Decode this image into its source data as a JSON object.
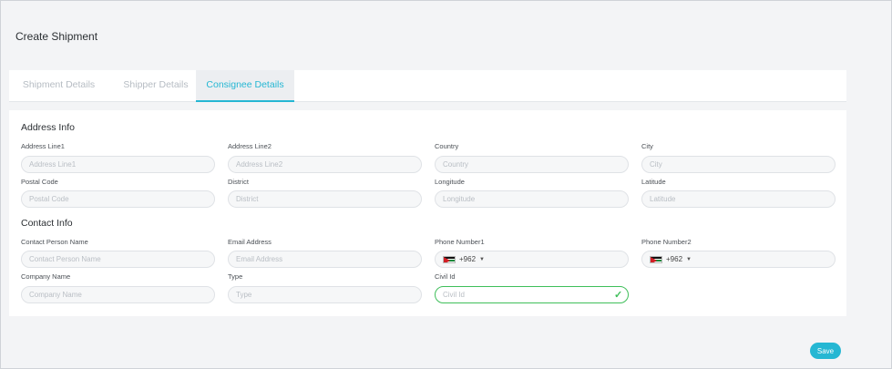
{
  "page": {
    "title": "Create Shipment"
  },
  "tabs": [
    {
      "label": "Shipment Details"
    },
    {
      "label": "Shipper Details"
    },
    {
      "label": "Consignee Details"
    }
  ],
  "active_tab": "Consignee Details",
  "address_info": {
    "title": "Address Info",
    "address_line1": {
      "label": "Address Line1",
      "placeholder": "Address Line1",
      "value": ""
    },
    "address_line2": {
      "label": "Address Line2",
      "placeholder": "Address Line2",
      "value": ""
    },
    "country": {
      "label": "Country",
      "placeholder": "Country",
      "value": ""
    },
    "city": {
      "label": "City",
      "placeholder": "City",
      "value": ""
    },
    "postal_code": {
      "label": "Postal Code",
      "placeholder": "Postal Code",
      "value": ""
    },
    "district": {
      "label": "District",
      "placeholder": "District",
      "value": ""
    },
    "longitude": {
      "label": "Longitude",
      "placeholder": "Longitude",
      "value": ""
    },
    "latitude": {
      "label": "Latitude",
      "placeholder": "Latitude",
      "value": ""
    }
  },
  "contact_info": {
    "title": "Contact Info",
    "contact_person_name": {
      "label": "Contact Person Name",
      "placeholder": "Contact Person Name",
      "value": ""
    },
    "email_address": {
      "label": "Email Address",
      "placeholder": "Email Address",
      "value": ""
    },
    "phone_number1": {
      "label": "Phone Number1",
      "dial_code": "+962",
      "flag": "jordan-flag-icon"
    },
    "phone_number2": {
      "label": "Phone Number2",
      "dial_code": "+962",
      "flag": "jordan-flag-icon"
    },
    "company_name": {
      "label": "Company Name",
      "placeholder": "Company Name",
      "value": ""
    },
    "type": {
      "label": "Type",
      "placeholder": "Type",
      "value": ""
    },
    "civil_id": {
      "label": "Civil Id",
      "placeholder": "Civil Id",
      "value": "",
      "status": "valid"
    }
  },
  "actions": {
    "save_label": "Save"
  },
  "colors": {
    "accent": "#25b7d3",
    "valid": "#3fbf5a",
    "page_bg": "#f3f4f6",
    "muted_text": "#b6bcc3"
  }
}
